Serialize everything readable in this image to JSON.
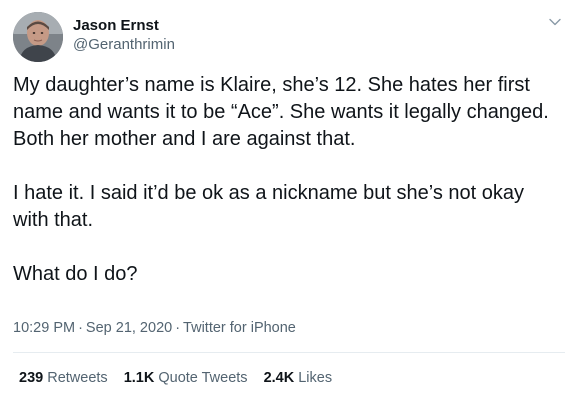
{
  "author": {
    "display_name": "Jason Ernst",
    "handle": "@Geranthrimin",
    "avatar_icon": "profile-photo"
  },
  "tweet": {
    "paragraphs": [
      "My daughter’s name is Klaire, she’s 12. She hates her first name and wants it to be “Ace”. She wants it legally changed. Both her mother and I are against that.",
      "I hate it. I said it’d be ok as a nickname but she’s not okay with that.",
      "What do I do?"
    ],
    "time": "10:29 PM",
    "date": "Sep 21, 2020",
    "source": "Twitter for iPhone",
    "separator": "·"
  },
  "stats": {
    "retweets": {
      "count": "239",
      "label": "Retweets"
    },
    "quotes": {
      "count": "1.1K",
      "label": "Quote Tweets"
    },
    "likes": {
      "count": "2.4K",
      "label": "Likes"
    }
  },
  "colors": {
    "text": "#0f1419",
    "secondary": "#536471",
    "divider": "#e6ecf0"
  }
}
